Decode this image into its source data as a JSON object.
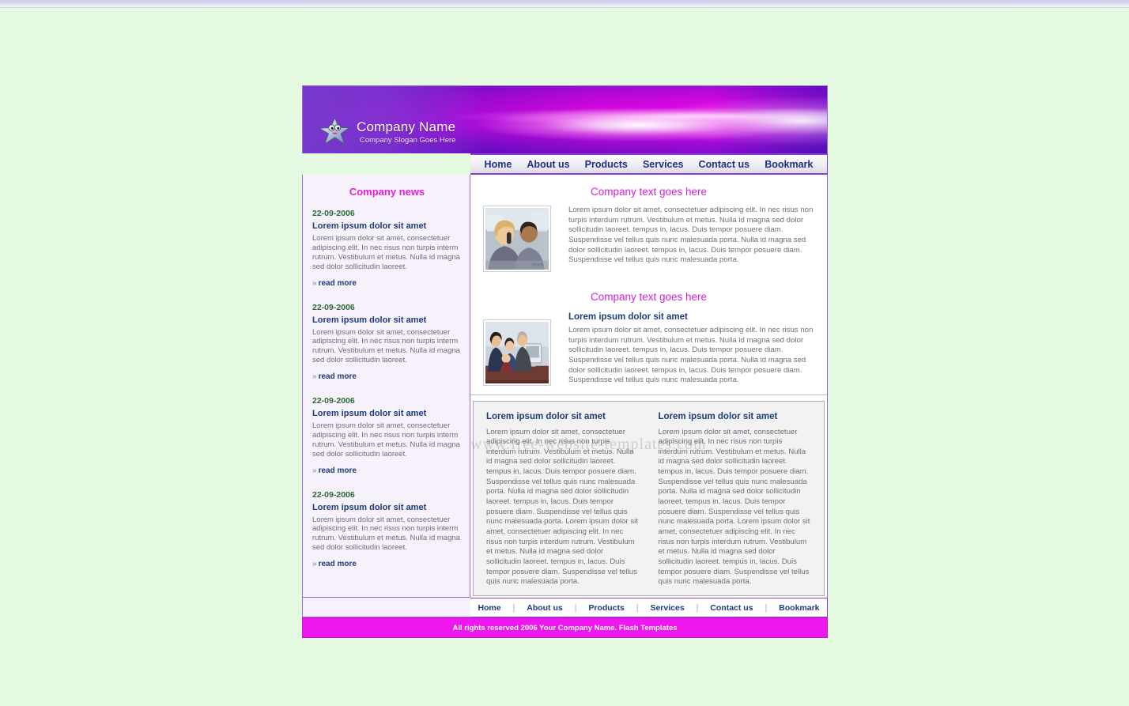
{
  "brand": {
    "company_name": "Company Name",
    "slogan": "Company Slogan Goes Here",
    "logo_icon": "star-mascot-icon",
    "header_gradient_from": "#7b3fd4",
    "header_gradient_to": "#f92ef6"
  },
  "colors": {
    "page_background": "#e4fbe2",
    "accent_magenta": "#ee18ee",
    "heading_pink": "#d41de0",
    "link_blue": "#1d3c7a",
    "date_green": "#2d6a36",
    "border_purple": "#8c3fd4",
    "sidebar_background": "#f6f1fb",
    "bottom_panel_background": "#f2f2f2"
  },
  "topnav": {
    "items": [
      {
        "label": "Home"
      },
      {
        "label": "About us"
      },
      {
        "label": "Products"
      },
      {
        "label": "Services"
      },
      {
        "label": "Contact us"
      },
      {
        "label": "Bookmark"
      }
    ]
  },
  "sidebar": {
    "title": "Company news",
    "read_more_label": "read more",
    "chevron": "»",
    "news": [
      {
        "date": "22-09-2006",
        "title": "Lorem ipsum dolor sit amet",
        "body": "Lorem ipsum dolor sit amet, consectetuer adipiscing elit. In nec risus non turpis interm rutrum. Vestibulum et metus. Nulla id magna sed dolor sollicitudin laoreet."
      },
      {
        "date": "22-09-2006",
        "title": "Lorem ipsum dolor sit amet",
        "body": "Lorem ipsum dolor sit amet, consectetuer adipiscing elit. In nec risus non turpis interm rutrum. Vestibulum et metus. Nulla id magna sed dolor sollicitudin laoreet."
      },
      {
        "date": "22-09-2006",
        "title": "Lorem ipsum dolor sit amet",
        "body": "Lorem ipsum dolor sit amet, consectetuer adipiscing elit. In nec risus non turpis interm rutrum. Vestibulum et metus. Nulla id magna sed dolor sollicitudin laoreet."
      },
      {
        "date": "22-09-2006",
        "title": "Lorem ipsum dolor sit amet",
        "body": "Lorem ipsum dolor sit amet, consectetuer adipiscing elit. In nec risus non turpis interm rutrum. Vestibulum et metus. Nulla id magna sed dolor sollicitudin laoreet."
      }
    ]
  },
  "main": {
    "block1": {
      "heading": "Company text goes here",
      "image_alt": "businesswoman-on-phone-photo",
      "body": "Lorem ipsum dolor sit amet, consectetuer adipiscing elit. In nec risus non turpis interdum rutrum. Vestibulum et metus. Nulla id magna sed dolor sollicitudin laoreet. tempus in, lacus. Duis tempor posuere diam. Suspendisse vel tellus quis nunc malesuada porta. Nulla id magna sed dolor sollicitudin laoreet. tempus in, lacus. Duis tempor posuere diam. Suspendisse vel tellus quis nunc malesuada porta."
    },
    "block2": {
      "heading": "Company text goes here",
      "sub_heading": "Lorem ipsum dolor sit amet",
      "image_alt": "business-team-at-computer-photo",
      "body": "Lorem ipsum dolor sit amet, consectetuer adipiscing elit. In nec risus non turpis interdum rutrum. Vestibulum et metus. Nulla id magna sed dolor sollicitudin laoreet. tempus in, lacus. Duis tempor posuere diam. Suspendisse vel tellus quis nunc malesuada porta. Nulla id magna sed dolor sollicitudin laoreet. tempus in, lacus. Duis tempor posuere diam. Suspendisse vel tellus quis nunc malesuada porta."
    },
    "watermark": "www.free-website-templates.com",
    "bottom_columns": [
      {
        "heading": "Lorem ipsum dolor sit amet",
        "body": "Lorem ipsum dolor sit amet, consectetuer adipiscing elit. In nec risus non turpis interdum rutrum. Vestibulum et metus. Nulla id magna sed dolor sollicitudin laoreet. tempus in, lacus. Duis tempor posuere diam. Suspendisse vel tellus quis nunc malesuada porta. Nulla id magna sed dolor sollicitudin laoreet. tempus in, lacus. Duis tempor posuere diam. Suspendisse vel tellus quis nunc malesuada porta. Lorem ipsum dolor sit amet, consectetuer adipiscing elit. In nec risus non turpis interdum rutrum. Vestibulum et metus. Nulla id magna sed dolor sollicitudin laoreet. tempus in, lacus. Duis tempor posuere diam. Suspendisse vel tellus quis nunc malesuada porta."
      },
      {
        "heading": "Lorem ipsum dolor sit amet",
        "body": "Lorem ipsum dolor sit amet, consectetuer adipiscing elit. In nec risus non turpis interdum rutrum. Vestibulum et metus. Nulla id magna sed dolor sollicitudin laoreet. tempus in, lacus. Duis tempor posuere diam. Suspendisse vel tellus quis nunc malesuada porta. Nulla id magna sed dolor sollicitudin laoreet. tempus in, lacus. Duis tempor posuere diam. Suspendisse vel tellus quis nunc malesuada porta. Lorem ipsum dolor sit amet, consectetuer adipiscing elit. In nec risus non turpis interdum rutrum. Vestibulum et metus. Nulla id magna sed dolor sollicitudin laoreet. tempus in, lacus. Duis tempor posuere diam. Suspendisse vel tellus quis nunc malesuada porta."
      }
    ]
  },
  "footernav": {
    "items": [
      {
        "label": "Home"
      },
      {
        "label": "About us"
      },
      {
        "label": "Products"
      },
      {
        "label": "Services"
      },
      {
        "label": "Contact us"
      },
      {
        "label": "Bookmark"
      }
    ],
    "separator": "|"
  },
  "copyright": "All rights reserved 2006 Your Company Name. Flash Templates"
}
